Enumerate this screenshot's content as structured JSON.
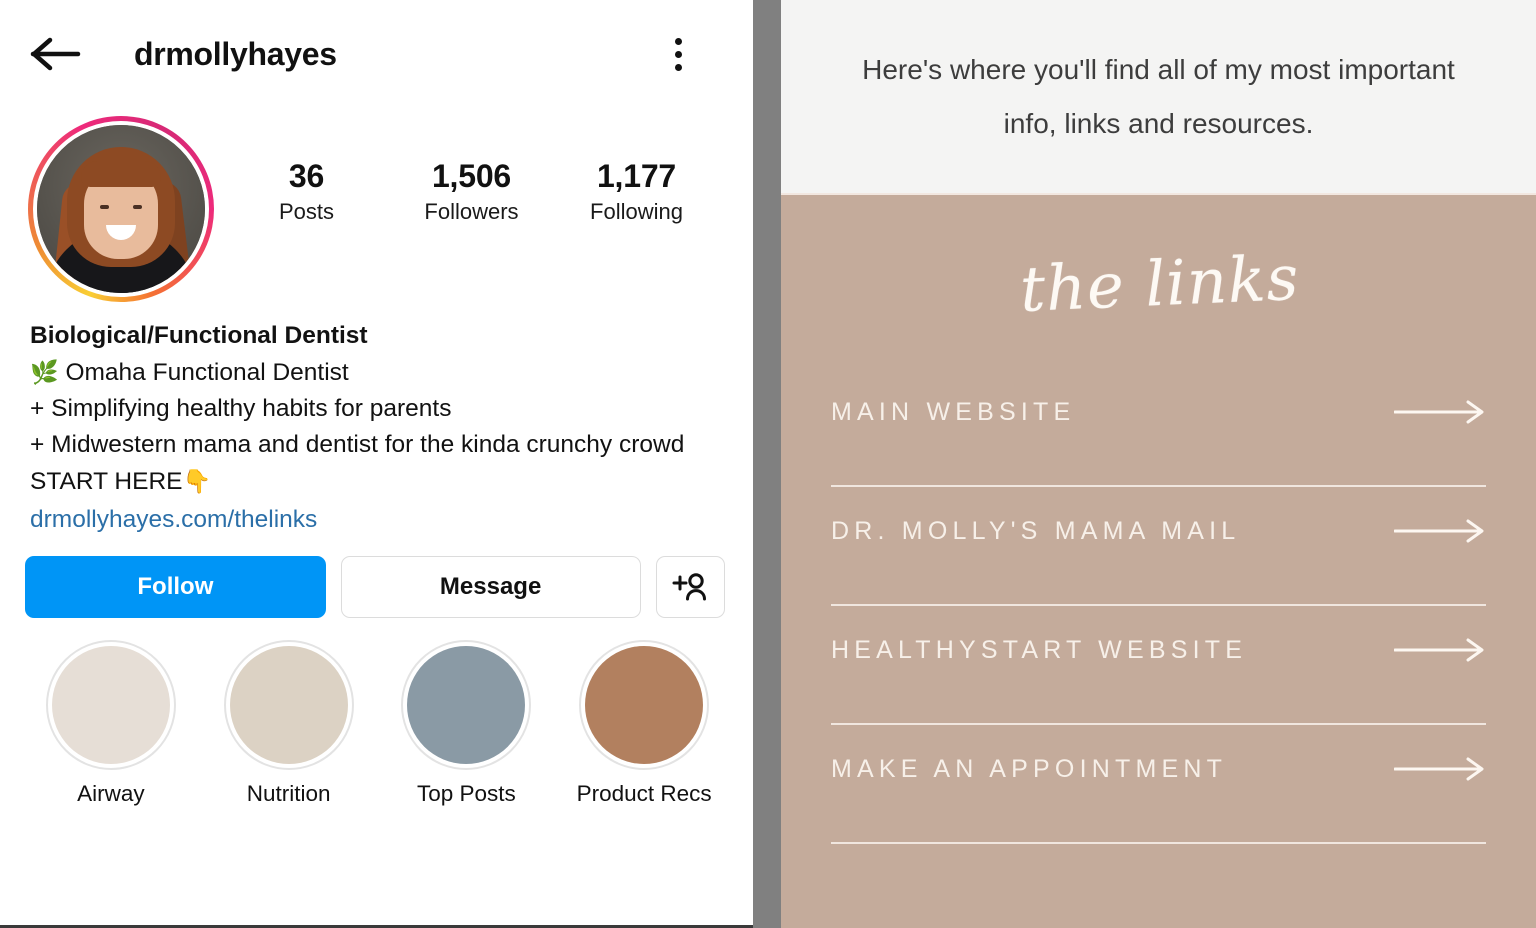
{
  "left_panel": {
    "header": {
      "back_icon": "back-arrow-icon",
      "username": "drmollyhayes",
      "menu_icon": "kebab-menu-icon"
    },
    "avatar": {
      "alt": "profile-photo",
      "has_story_ring": true,
      "ring_colors": [
        "#f9ce34",
        "#ee8c34",
        "#ee2a7b",
        "#d62976"
      ]
    },
    "stats": [
      {
        "value": "36",
        "label": "Posts"
      },
      {
        "value": "1,506",
        "label": "Followers"
      },
      {
        "value": "1,177",
        "label": "Following"
      }
    ],
    "bio": {
      "name": "Biological/Functional Dentist",
      "line_1_emoji": "🌿",
      "line_1": "Omaha Functional Dentist",
      "line_2": "+ Simplifying healthy habits for parents",
      "line_3": "+ Midwestern mama and dentist for the kinda crunchy crowd",
      "line_4": "START HERE",
      "line_4_emoji": "👇",
      "link": "drmollyhayes.com/thelinks",
      "link_color": "#2b6fa8"
    },
    "actions": {
      "follow_label": "Follow",
      "follow_color": "#0095f6",
      "message_label": "Message",
      "add_person_icon": "add-person-icon"
    },
    "highlights": [
      {
        "label": "Airway",
        "color": "#e6ded6"
      },
      {
        "label": "Nutrition",
        "color": "#dcd2c4"
      },
      {
        "label": "Top Posts",
        "color": "#8a9aa5"
      },
      {
        "label": "Product Recs",
        "color": "#b2805f"
      }
    ]
  },
  "right_panel": {
    "intro": "Here's where you'll find all of my most important info, links and resources.",
    "title": "the links",
    "background_color": "#c4ab9b",
    "header_background": "#f4f4f3",
    "links": [
      {
        "label": "MAIN WEBSITE",
        "arrow_icon": "arrow-right-icon"
      },
      {
        "label": "DR. MOLLY'S MAMA MAIL",
        "arrow_icon": "arrow-right-icon"
      },
      {
        "label": "HEALTHYSTART WEBSITE",
        "arrow_icon": "arrow-right-icon"
      },
      {
        "label": "MAKE AN APPOINTMENT",
        "arrow_icon": "arrow-right-icon"
      }
    ]
  }
}
